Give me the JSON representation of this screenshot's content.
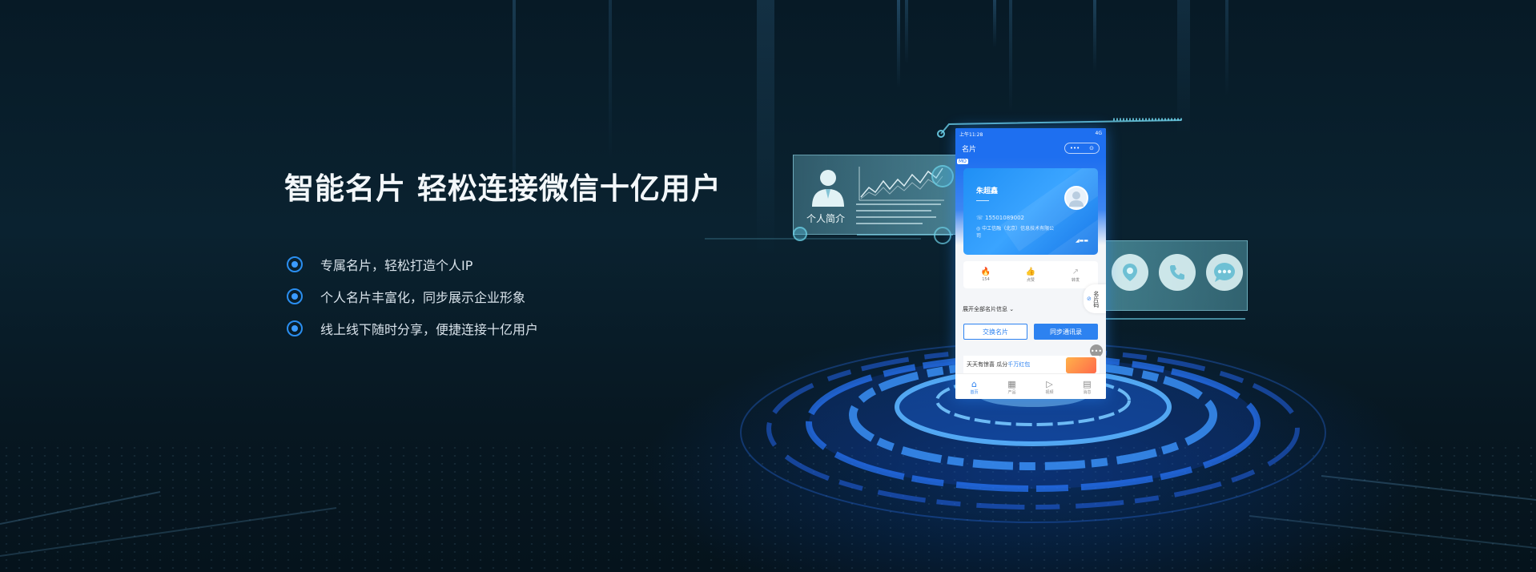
{
  "hero": {
    "headline": "智能名片 轻松连接微信十亿用户",
    "features": [
      "专属名片，轻松打造个人IP",
      "个人名片丰富化，同步展示企业形象",
      "线上线下随时分享，便捷连接十亿用户"
    ]
  },
  "holo_left": {
    "label": "个人简介"
  },
  "phone": {
    "status_time": "上午11:28",
    "status_right": "4G",
    "nav_title": "名片",
    "capsule_dots": "•••",
    "capsule_target": "⊙",
    "badge": "MO",
    "card": {
      "name": "朱超鑫",
      "phone": "15501089002",
      "company": "中工信融（北京）信息技术有限公司"
    },
    "stats": [
      {
        "icon": "fire-icon",
        "glyph": "🔥",
        "label": "154"
      },
      {
        "icon": "thumbs-up-icon",
        "glyph": "👍",
        "label": "点赞"
      },
      {
        "icon": "share-icon",
        "glyph": "↗",
        "label": "转发"
      }
    ],
    "side_code": {
      "label": "名片码"
    },
    "expand_text": "展开全部名片信息",
    "btn_exchange": "交换名片",
    "btn_sync": "同步通讯录",
    "more": "•••",
    "promo": {
      "prefix": "天天有惊喜 瓜分",
      "highlight": "千万红包"
    },
    "tabs": [
      {
        "icon": "home-icon",
        "glyph": "⌂",
        "label": "首页"
      },
      {
        "icon": "grid-icon",
        "glyph": "▦",
        "label": "产品"
      },
      {
        "icon": "play-icon",
        "glyph": "▷",
        "label": "视频"
      },
      {
        "icon": "message-icon",
        "glyph": "▤",
        "label": "消息"
      }
    ]
  },
  "colors": {
    "accent": "#2d82f0",
    "phone_header": "#1e6ff0",
    "bullet": "#3b9bff",
    "holo": "#6ec8dc"
  }
}
